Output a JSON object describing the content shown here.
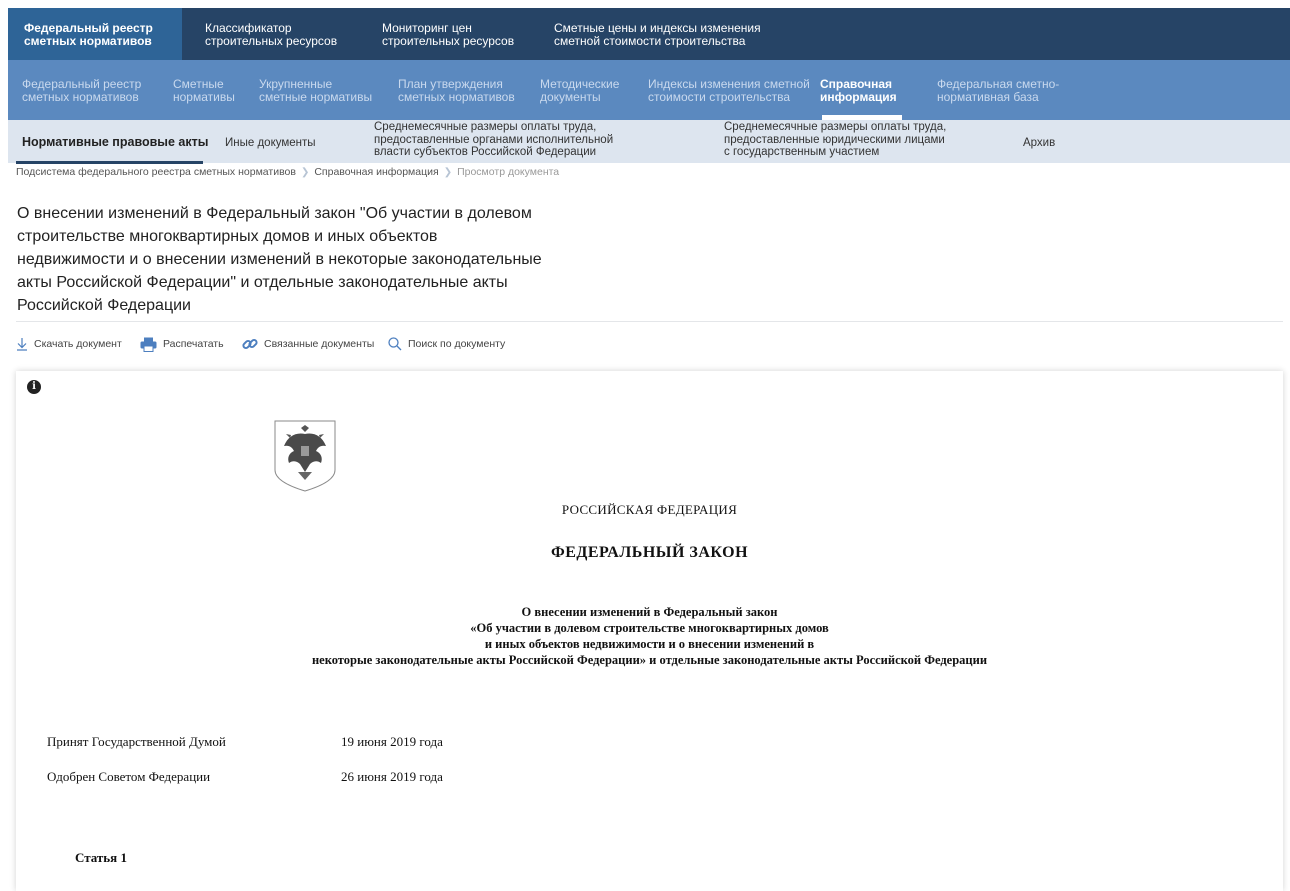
{
  "nav_primary": [
    {
      "line1": "Федеральный реестр",
      "line2": "сметных нормативов"
    },
    {
      "line1": "Классификатор",
      "line2": "строительных ресурсов"
    },
    {
      "line1": "Мониторинг цен",
      "line2": "строительных ресурсов"
    },
    {
      "line1": "Сметные цены и индексы изменения",
      "line2": "сметной стоимости строительства"
    }
  ],
  "nav_secondary": [
    {
      "line1": "Федеральный реестр",
      "line2": "сметных нормативов"
    },
    {
      "line1": "Сметные",
      "line2": "нормативы"
    },
    {
      "line1": "Укрупненные",
      "line2": "сметные нормативы"
    },
    {
      "line1": "План утверждения",
      "line2": "сметных нормативов"
    },
    {
      "line1": "Методические",
      "line2": "документы"
    },
    {
      "line1": "Индексы изменения сметной",
      "line2": "стоимости строительства"
    },
    {
      "line1": "Справочная",
      "line2": "информация"
    },
    {
      "line1": "Федеральная сметно-",
      "line2": "нормативная база"
    }
  ],
  "nav_tertiary": [
    {
      "line1": "Нормативные правовые акты"
    },
    {
      "line1": "Иные документы"
    },
    {
      "line1": "Среднемесячные размеры оплаты труда,",
      "line2": "предоставленные органами исполнительной",
      "line3": "власти субъектов Российской Федерации"
    },
    {
      "line1": "Среднемесячные размеры оплаты труда,",
      "line2": "предоставленные юридическими лицами",
      "line3": "с государственным участием"
    },
    {
      "line1": "Архив"
    }
  ],
  "breadcrumb": {
    "items": [
      "Подсистема федерального реестра сметных нормативов",
      "Справочная информация",
      "Просмотр документа"
    ]
  },
  "page_title": "О внесении изменений в Федеральный закон \"Об участии в долевом строительстве многоквартирных домов и иных объектов недвижимости и о внесении изменений в некоторые законодательные акты Российской Федерации\" и отдельные законодательные акты Российской Федерации",
  "toolbar": {
    "download": "Скачать документ",
    "print": "Распечатать",
    "related": "Связанные документы",
    "search": "Поиск по документу"
  },
  "document": {
    "info_glyph": "i",
    "country": "РОССИЙСКАЯ ФЕДЕРАЦИЯ",
    "law_type": "ФЕДЕРАЛЬНЫЙ ЗАКОН",
    "law_title": [
      "О внесении изменений в Федеральный закон",
      "«Об участии в долевом строительстве многоквартирных домов",
      "и иных объектов недвижимости и о внесении изменений в",
      "некоторые законодательные акты Российской Федерации» и отдельные законодательные акты Российской Федерации"
    ],
    "adopted_label": "Принят Государственной Думой",
    "adopted_date": "19 июня 2019 года",
    "approved_label": "Одобрен Советом Федерации",
    "approved_date": "26 июня 2019 года",
    "article_heading": "Статья 1"
  },
  "colors": {
    "nav_primary_bg": "#264466",
    "nav_primary_active_bg": "#2e6497",
    "nav_secondary_bg": "#5b89bf",
    "nav_tertiary_bg": "#dde5ef",
    "icon_blue": "#4d7fbf"
  }
}
